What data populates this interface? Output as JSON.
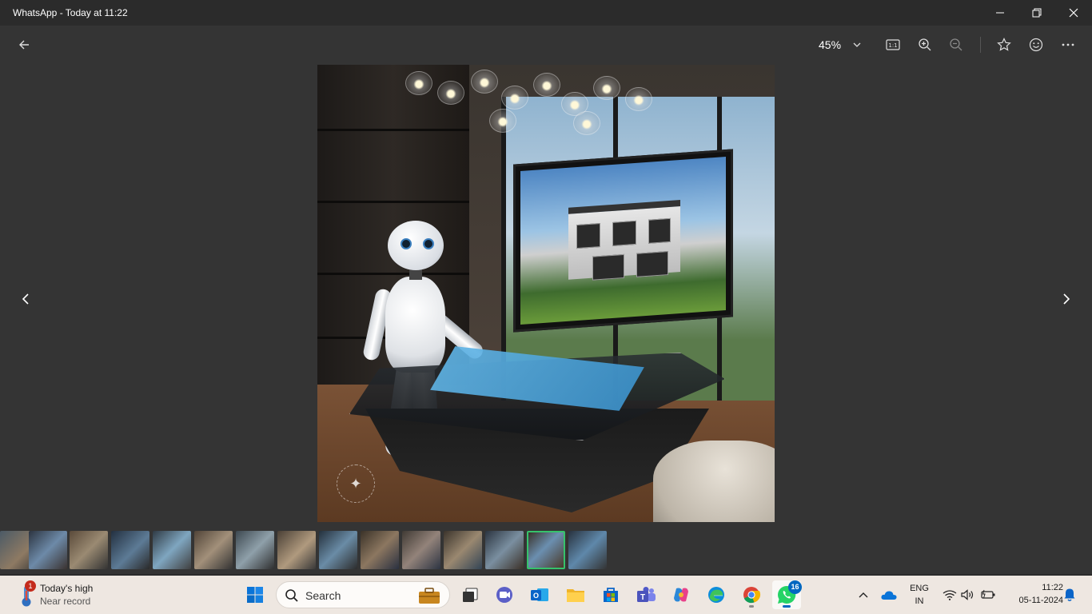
{
  "window": {
    "title": "WhatsApp - Today at 11:22"
  },
  "toolbar": {
    "zoom_level": "45%"
  },
  "filmstrip": {
    "count": 15,
    "selected_index": 13
  },
  "taskbar": {
    "weather": {
      "title": "Today's high",
      "subtitle": "Near record",
      "badge": "1"
    },
    "search": {
      "placeholder": "Search"
    },
    "whatsapp_badge": "16",
    "lang": {
      "line1": "ENG",
      "line2": "IN"
    },
    "clock": {
      "time": "11:22",
      "date": "05-11-2024"
    }
  },
  "colors": {
    "selected_thumb": "#36c26b",
    "accent": "#0067c0",
    "badge_red": "#c42b1c"
  }
}
